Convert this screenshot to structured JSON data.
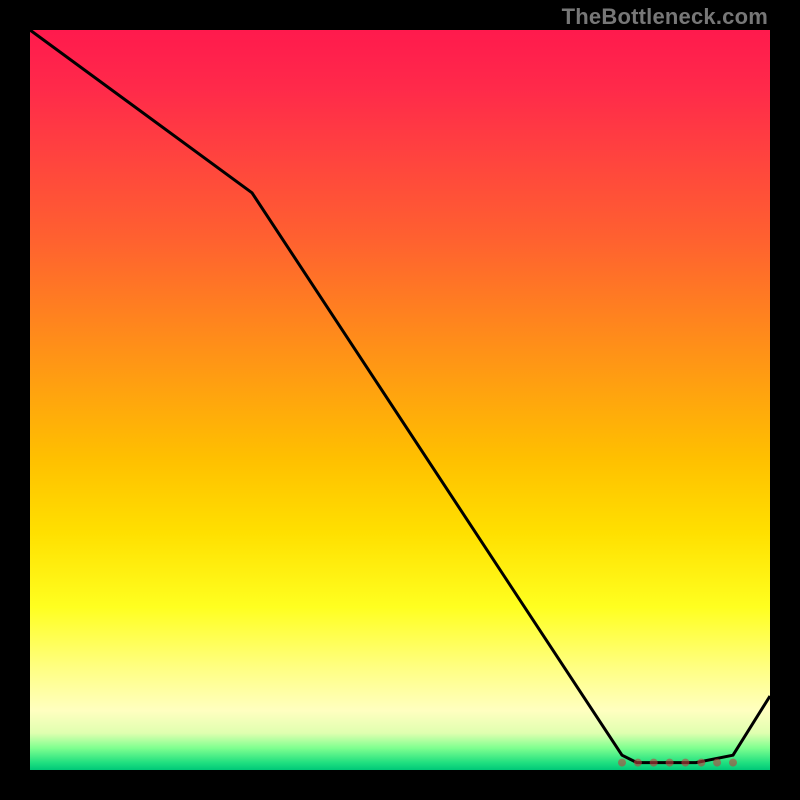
{
  "watermark": "TheBottleneck.com",
  "chart_data": {
    "type": "line",
    "title": "",
    "xlabel": "",
    "ylabel": "",
    "xlim": [
      0,
      100
    ],
    "ylim": [
      0,
      100
    ],
    "gradient_background": true,
    "series": [
      {
        "name": "curve",
        "x": [
          0,
          30,
          80,
          82,
          90,
          95,
          100
        ],
        "values": [
          100,
          78,
          2,
          1,
          1,
          2,
          10
        ]
      }
    ],
    "marker_cluster": {
      "x_range": [
        80,
        95
      ],
      "y": 1,
      "count": 8
    }
  }
}
